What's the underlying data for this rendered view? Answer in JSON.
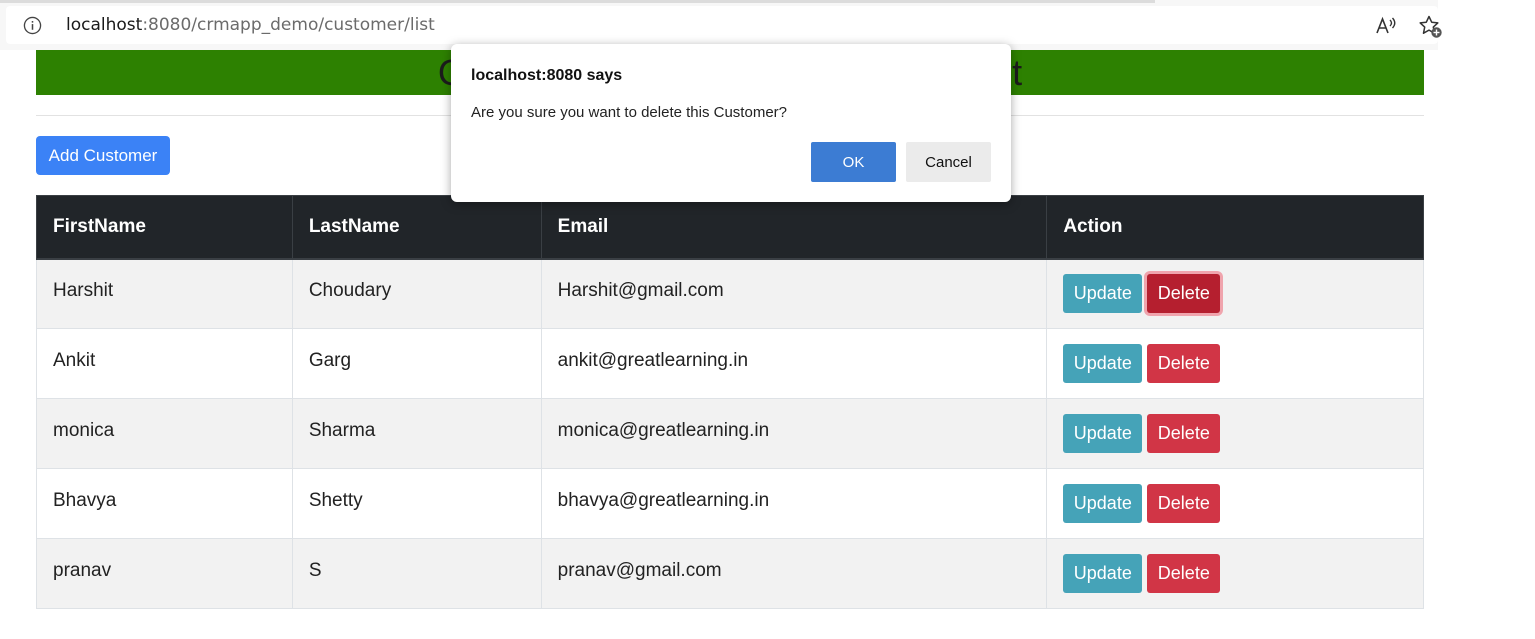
{
  "browser": {
    "url_host": "localhost",
    "url_rest": ":8080/crmapp_demo/customer/list",
    "icons": [
      "info-icon",
      "read-aloud-icon",
      "add-favorite-icon"
    ]
  },
  "page": {
    "header_title": "Customer Relationship Management",
    "header_color": "#2d8101",
    "add_button_label": "Add Customer"
  },
  "table": {
    "columns": [
      "FirstName",
      "LastName",
      "Email",
      "Action"
    ],
    "rows": [
      {
        "first": "Harshit",
        "last": "Choudary",
        "email": "Harshit@gmail.com",
        "update": "Update",
        "delete": "Delete"
      },
      {
        "first": "Ankit",
        "last": "Garg",
        "email": "ankit@greatlearning.in",
        "update": "Update",
        "delete": "Delete"
      },
      {
        "first": "monica",
        "last": "Sharma",
        "email": "monica@greatlearning.in",
        "update": "Update",
        "delete": "Delete"
      },
      {
        "first": "Bhavya",
        "last": "Shetty",
        "email": "bhavya@greatlearning.in",
        "update": "Update",
        "delete": "Delete"
      },
      {
        "first": "pranav",
        "last": "S",
        "email": "pranav@gmail.com",
        "update": "Update",
        "delete": "Delete"
      }
    ]
  },
  "dialog": {
    "title": "localhost:8080 says",
    "message": "Are you sure you want to delete this Customer?",
    "ok_label": "OK",
    "cancel_label": "Cancel"
  },
  "colors": {
    "update_button": "#45a3b8",
    "delete_button": "#d13546",
    "add_button": "#3b82f6",
    "table_header": "#212529",
    "ok_button": "#3c7cd3"
  }
}
